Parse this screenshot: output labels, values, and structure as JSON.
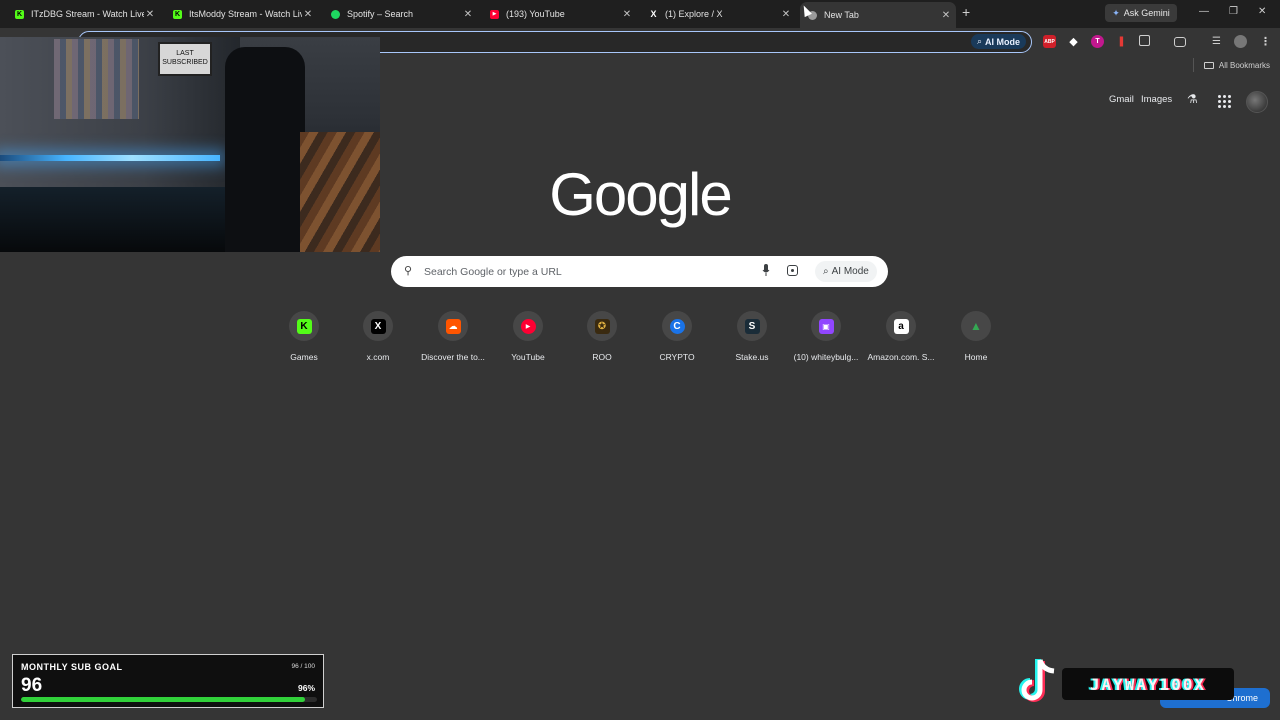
{
  "tabs": [
    {
      "title": "ITzDBG Stream - Watch Live on",
      "icon": "kick-icon",
      "color": "#53fc18",
      "active": false
    },
    {
      "title": "ItsModdy Stream - Watch Live o",
      "icon": "kick-icon",
      "color": "#53fc18",
      "active": false
    },
    {
      "title": "Spotify – Search",
      "icon": "spotify-icon",
      "color": "#1ed760",
      "active": false
    },
    {
      "title": "(193) YouTube",
      "icon": "youtube-icon",
      "color": "#ff0033",
      "active": false
    },
    {
      "title": "(1) Explore / X",
      "icon": "x-icon",
      "color": "#ffffff",
      "active": false
    },
    {
      "title": "New Tab",
      "icon": "chrome-icon",
      "color": "#bdbdbd",
      "active": true
    }
  ],
  "ask_gemini": "Ask Gemini",
  "omnibox": {
    "ai_mode_label": "AI Mode"
  },
  "bookmarks": {
    "all_bookmarks": "All Bookmarks"
  },
  "google_header": {
    "gmail": "Gmail",
    "images": "Images"
  },
  "logo_text": "Google",
  "search": {
    "placeholder": "Search Google or type a URL",
    "ai_mode_label": "AI Mode"
  },
  "shortcuts": [
    {
      "label": "Games",
      "icon": "kick-icon",
      "glyph": "K",
      "bg": "#53fc18",
      "fg": "#000000"
    },
    {
      "label": "x.com",
      "icon": "x-icon",
      "glyph": "X",
      "bg": "#000000",
      "fg": "#ffffff"
    },
    {
      "label": "Discover the to...",
      "icon": "soundcloud-icon",
      "glyph": "☁",
      "bg": "#ff5500",
      "fg": "#ffffff"
    },
    {
      "label": "YouTube",
      "icon": "youtube-icon",
      "glyph": "▶",
      "bg": "#ff0033",
      "fg": "#ffffff"
    },
    {
      "label": "ROO",
      "icon": "roo-icon",
      "glyph": "✪",
      "bg": "#3a2a10",
      "fg": "#e0b040"
    },
    {
      "label": "CRYPTO",
      "icon": "crypto-icon",
      "glyph": "C",
      "bg": "#1a73e8",
      "fg": "#ffffff"
    },
    {
      "label": "Stake.us",
      "icon": "stake-icon",
      "glyph": "S",
      "bg": "#1a2c38",
      "fg": "#ffffff"
    },
    {
      "label": "(10) whiteybulg...",
      "icon": "twitch-icon",
      "glyph": "▣",
      "bg": "#9146ff",
      "fg": "#ffffff"
    },
    {
      "label": "Amazon.com. S...",
      "icon": "amazon-icon",
      "glyph": "a",
      "bg": "#ffffff",
      "fg": "#000000"
    },
    {
      "label": "Home",
      "icon": "google-drive-icon",
      "glyph": "▲",
      "bg": "transparent",
      "fg": "#34a853"
    }
  ],
  "webcam_sign": "LAST SUBSCRIBED",
  "sub_goal": {
    "title": "MONTHLY SUB GOAL",
    "value": "96",
    "count": "96 / 100",
    "percent": "96%",
    "progress": 0.96
  },
  "tiktok": {
    "handle": "JAYWAY100X",
    "chip": "Chrome"
  },
  "colors": {
    "page_bg": "#353535",
    "tab_strip": "#1f1f1f",
    "accent_blue": "#a8c7fa",
    "goal_green": "#31d13a"
  }
}
